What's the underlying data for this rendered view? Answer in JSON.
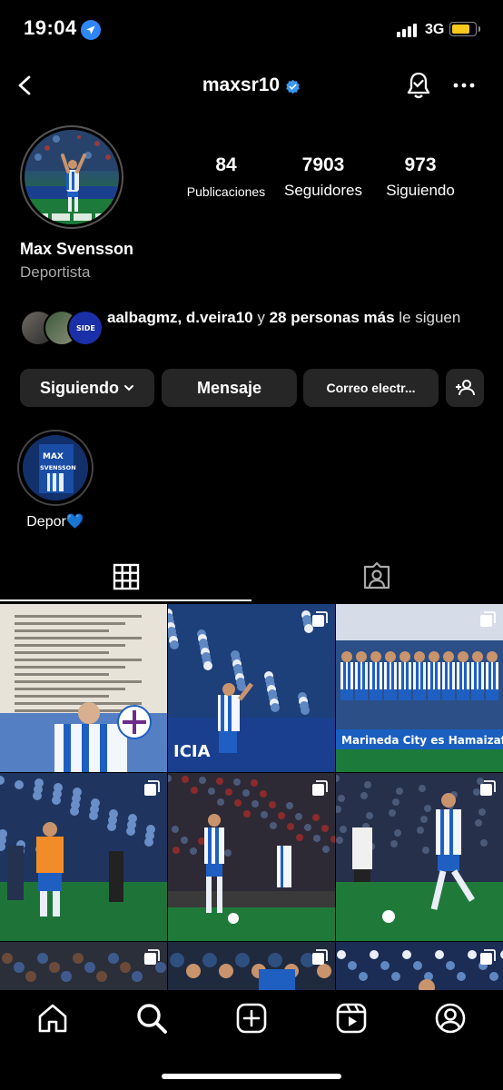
{
  "status_bar": {
    "time": "19:04",
    "network": "3G"
  },
  "header": {
    "username": "maxsr10"
  },
  "profile": {
    "posts_count": "84",
    "posts_label": "Publicaciones",
    "followers_count": "7903",
    "followers_label": "Seguidores",
    "following_count": "973",
    "following_label": "Siguiendo",
    "display_name": "Max Svensson",
    "category": "Deportista",
    "followed_by_names": "aalbagmz, d.veira10",
    "followed_by_connector": " y ",
    "followed_by_more": "28 personas más",
    "followed_by_tail": " le siguen"
  },
  "actions": {
    "following_label": "Siguiendo",
    "message_label": "Mensaje",
    "email_label": "Correo electr..."
  },
  "highlights": [
    {
      "label": "Depor💙"
    }
  ],
  "tabs": [
    {
      "name": "posts-grid",
      "active": true
    },
    {
      "name": "tagged",
      "active": false
    }
  ],
  "colors": {
    "verified": "#3897f0",
    "button_bg": "#262626",
    "battery": "#f6c91c",
    "location": "#2f86f6"
  },
  "icons": [
    "location-arrow-icon",
    "signal-icon",
    "battery-icon",
    "back-arrow-icon",
    "verified-badge-icon",
    "bell-check-icon",
    "more-dots-icon",
    "chevron-down-icon",
    "add-person-icon",
    "grid-icon",
    "tagged-icon",
    "multi-image-icon",
    "home-icon",
    "search-icon",
    "create-icon",
    "reels-icon",
    "profile-icon"
  ],
  "grid_posts": [
    {
      "name": "post-farewell-letter",
      "multi": false
    },
    {
      "name": "post-celebration-fans",
      "multi": true
    },
    {
      "name": "post-team-photo",
      "multi": true
    },
    {
      "name": "post-warmup-bib",
      "multi": true
    },
    {
      "name": "post-match-running",
      "multi": true
    },
    {
      "name": "post-match-dribble",
      "multi": true
    },
    {
      "name": "post-crowd-1",
      "multi": true
    },
    {
      "name": "post-crowd-2",
      "multi": true
    },
    {
      "name": "post-crowd-3",
      "multi": true
    }
  ]
}
